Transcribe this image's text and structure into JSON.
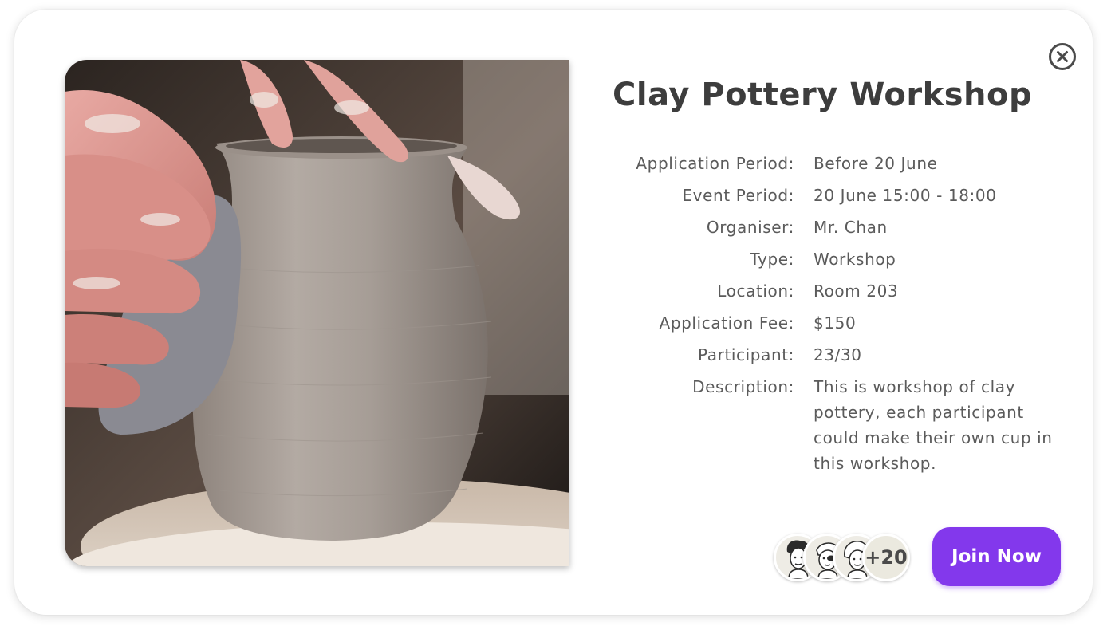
{
  "event": {
    "title": "Clay Pottery Workshop",
    "details": [
      {
        "label": "Application Period:",
        "value": "Before 20 June"
      },
      {
        "label": "Event Period:",
        "value": "20 June 15:00 - 18:00"
      },
      {
        "label": "Organiser:",
        "value": "Mr. Chan"
      },
      {
        "label": "Type:",
        "value": "Workshop"
      },
      {
        "label": "Location:",
        "value": "Room 203"
      },
      {
        "label": "Application Fee:",
        "value": "$150"
      },
      {
        "label": "Participant:",
        "value": "23/30"
      },
      {
        "label": "Description:",
        "value": "This is workshop of clay pottery, each participant could make their own cup in this workshop."
      }
    ]
  },
  "participants": {
    "avatars": [
      "avatar-1",
      "avatar-2",
      "avatar-3"
    ],
    "more_label": "+20"
  },
  "actions": {
    "join_label": "Join Now",
    "close_icon": "close-circle-icon"
  },
  "colors": {
    "accent": "#8338ec",
    "title": "#3d3d3d",
    "text": "#5b5b5b"
  }
}
